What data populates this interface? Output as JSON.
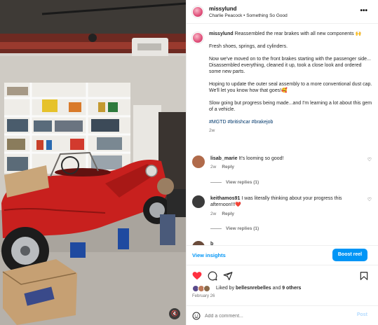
{
  "post": {
    "username": "missylund",
    "audio": "Charlie Peacock • Something So Good",
    "more_icon": "more-horizontal-icon"
  },
  "caption": {
    "username": "missylund",
    "lead": "Reassembled the rear brakes with all new components 🙌",
    "paragraphs": [
      "Fresh shoes, springs, and cylinders.",
      "Now we've moved on to the front brakes starting with the passenger side... Disassembled everything, cleaned it up, took a close look and ordered some new parts.",
      "Hoping to update the outer seal assembly to a more conventional dust cap. We'll let you know how that goes!🥰",
      "Slow going but progress being made...and I'm learning a lot about this gem of a vehicle."
    ],
    "hashtags": "#MGTD #britishcar #brakejob",
    "time": "2w"
  },
  "comments": [
    {
      "username": "lisab_marie",
      "text": "It's looming so good!",
      "time": "2w",
      "reply_label": "Reply",
      "view_replies": "View replies (1)",
      "avatar_color": "#b06a4a"
    },
    {
      "username": "keithamos91",
      "text": "I was literally thinking about your progress this afternoon!!!❤️",
      "time": "2w",
      "reply_label": "Reply",
      "view_replies": "View replies (1)",
      "avatar_color": "#3b3b3b"
    },
    {
      "username": "b",
      "text": "",
      "avatar_color": "#6a4b3a"
    }
  ],
  "insights": {
    "view_label": "View insights",
    "boost_label": "Boost reel"
  },
  "actions": {
    "like_icon": "heart-filled-icon",
    "comment_icon": "comment-icon",
    "share_icon": "send-icon",
    "save_icon": "bookmark-icon",
    "like_color": "#ff3040"
  },
  "likes": {
    "prefix": "Liked by",
    "user": "bellesnrebelles",
    "and": "and",
    "others": "9 others"
  },
  "date": "February 26",
  "add_comment": {
    "placeholder": "Add a comment...",
    "post_label": "Post",
    "emoji_icon": "emoji-icon"
  },
  "colors": {
    "accent": "#0095f6",
    "car_red": "#c8201e"
  }
}
